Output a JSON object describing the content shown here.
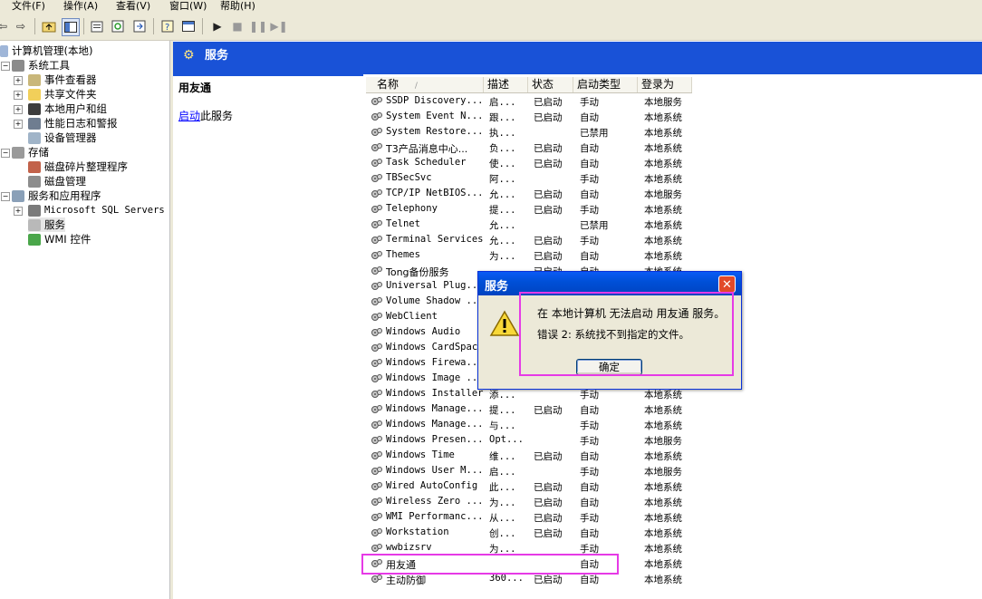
{
  "menu": [
    "文件(F)",
    "操作(A)",
    "查看(V)",
    "窗口(W)",
    "帮助(H)"
  ],
  "tree": {
    "root": "计算机管理(本地)",
    "system_tools": "系统工具",
    "event_viewer": "事件查看器",
    "shared_folders": "共享文件夹",
    "local_users": "本地用户和组",
    "perf_logs": "性能日志和警报",
    "device_manager": "设备管理器",
    "storage": "存储",
    "defrag": "磁盘碎片整理程序",
    "disk_mgmt": "磁盘管理",
    "services_apps": "服务和应用程序",
    "sql_servers": "Microsoft SQL Servers",
    "services": "服务",
    "wmi": "WMI 控件"
  },
  "header": {
    "title": "服务"
  },
  "detail": {
    "service_name": "用友通",
    "start_link": "启动",
    "start_suffix": "此服务"
  },
  "columns": {
    "name": "名称",
    "desc": "描述",
    "status": "状态",
    "start_type": "启动类型",
    "logon": "登录为"
  },
  "services": [
    {
      "name": "SSDP Discovery...",
      "desc": "启...",
      "status": "已启动",
      "type": "手动",
      "logon": "本地服务"
    },
    {
      "name": "System Event N...",
      "desc": "跟...",
      "status": "已启动",
      "type": "自动",
      "logon": "本地系统"
    },
    {
      "name": "System Restore...",
      "desc": "执...",
      "status": "",
      "type": "已禁用",
      "logon": "本地系统"
    },
    {
      "name": "T3产品消息中心...",
      "desc": "负...",
      "status": "已启动",
      "type": "自动",
      "logon": "本地系统"
    },
    {
      "name": "Task Scheduler",
      "desc": "使...",
      "status": "已启动",
      "type": "自动",
      "logon": "本地系统"
    },
    {
      "name": "TBSecSvc",
      "desc": "阿...",
      "status": "",
      "type": "手动",
      "logon": "本地系统"
    },
    {
      "name": "TCP/IP NetBIOS...",
      "desc": "允...",
      "status": "已启动",
      "type": "自动",
      "logon": "本地服务"
    },
    {
      "name": "Telephony",
      "desc": "提...",
      "status": "已启动",
      "type": "手动",
      "logon": "本地系统"
    },
    {
      "name": "Telnet",
      "desc": "允...",
      "status": "",
      "type": "已禁用",
      "logon": "本地系统"
    },
    {
      "name": "Terminal Services",
      "desc": "允...",
      "status": "已启动",
      "type": "手动",
      "logon": "本地系统"
    },
    {
      "name": "Themes",
      "desc": "为...",
      "status": "已启动",
      "type": "自动",
      "logon": "本地系统"
    },
    {
      "name": "Tong备份服务",
      "desc": "",
      "status": "已启动",
      "type": "自动",
      "logon": "本地系统"
    },
    {
      "name": "Universal Plug...",
      "desc": "",
      "status": "",
      "type": "",
      "logon": ""
    },
    {
      "name": "Volume Shadow ...",
      "desc": "",
      "status": "",
      "type": "",
      "logon": ""
    },
    {
      "name": "WebClient",
      "desc": "",
      "status": "",
      "type": "",
      "logon": ""
    },
    {
      "name": "Windows Audio",
      "desc": "",
      "status": "",
      "type": "",
      "logon": ""
    },
    {
      "name": "Windows CardSpace",
      "desc": "",
      "status": "",
      "type": "",
      "logon": ""
    },
    {
      "name": "Windows Firewa...",
      "desc": "",
      "status": "",
      "type": "",
      "logon": ""
    },
    {
      "name": "Windows Image ...",
      "desc": "",
      "status": "",
      "type": "",
      "logon": ""
    },
    {
      "name": "Windows Installer",
      "desc": "添...",
      "status": "",
      "type": "手动",
      "logon": "本地系统"
    },
    {
      "name": "Windows Manage...",
      "desc": "提...",
      "status": "已启动",
      "type": "自动",
      "logon": "本地系统"
    },
    {
      "name": "Windows Manage...",
      "desc": "与...",
      "status": "",
      "type": "手动",
      "logon": "本地系统"
    },
    {
      "name": "Windows Presen...",
      "desc": "Opt...",
      "status": "",
      "type": "手动",
      "logon": "本地服务"
    },
    {
      "name": "Windows Time",
      "desc": "维...",
      "status": "已启动",
      "type": "自动",
      "logon": "本地系统"
    },
    {
      "name": "Windows User M...",
      "desc": "启...",
      "status": "",
      "type": "手动",
      "logon": "本地服务"
    },
    {
      "name": "Wired AutoConfig",
      "desc": "此...",
      "status": "已启动",
      "type": "自动",
      "logon": "本地系统"
    },
    {
      "name": "Wireless Zero ...",
      "desc": "为...",
      "status": "已启动",
      "type": "自动",
      "logon": "本地系统"
    },
    {
      "name": "WMI Performanc...",
      "desc": "从...",
      "status": "已启动",
      "type": "手动",
      "logon": "本地系统"
    },
    {
      "name": "Workstation",
      "desc": "创...",
      "status": "已启动",
      "type": "自动",
      "logon": "本地系统"
    },
    {
      "name": "wwbizsrv",
      "desc": "为...",
      "status": "",
      "type": "手动",
      "logon": "本地系统"
    },
    {
      "name": "用友通",
      "desc": "",
      "status": "",
      "type": "自动",
      "logon": "本地系统"
    },
    {
      "name": "主动防御",
      "desc": "360...",
      "status": "已启动",
      "type": "自动",
      "logon": "本地系统"
    }
  ],
  "dialog": {
    "title": "服务",
    "message": "在 本地计算机 无法启动 用友通 服务。",
    "error": "错误 2: 系统找不到指定的文件。",
    "ok": "确定",
    "close": "✕"
  },
  "colors": {
    "header_blue": "#1952d7",
    "highlight": "#e63ae6",
    "link": "#0000ff"
  }
}
